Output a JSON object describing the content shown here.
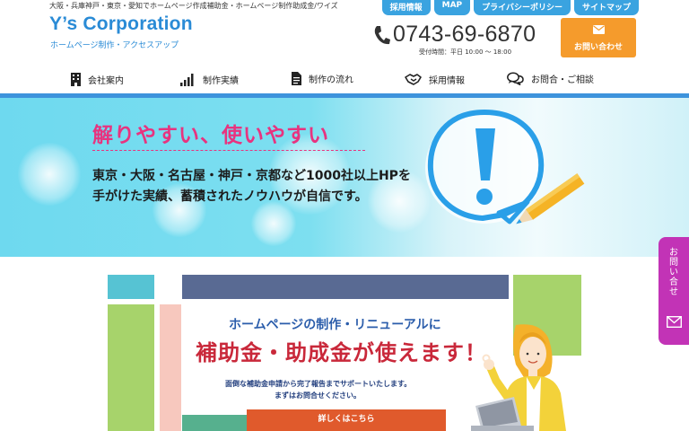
{
  "header": {
    "tagline": "大阪・兵庫神戸・東京・愛知でホームページ作成補助金・ホームページ制作助成金/ワイズ",
    "logo": "Y’s Corporation",
    "logo_sub": "ホームページ制作・アクセスアップ",
    "top_links": [
      "採用情報",
      "MAP",
      "プライバシーポリシー",
      "サイトマップ"
    ],
    "phone": "0743-69-6870",
    "hours": "受付時間：平日 10:00 ～ 18:00",
    "contact_button": "お問い合わせ"
  },
  "nav": {
    "items": [
      {
        "label": "会社案内",
        "icon": "building-icon"
      },
      {
        "label": "制作実績",
        "icon": "bar-chart-icon"
      },
      {
        "label": "制作の流れ",
        "icon": "document-icon"
      },
      {
        "label": "採用情報",
        "icon": "handshake-icon"
      },
      {
        "label": "お問合・ご相談",
        "icon": "chat-bubbles-icon"
      }
    ]
  },
  "hero": {
    "headline": "解りやすい、使いやすい",
    "line1": "東京・大阪・名古屋・神戸・京都など1000社以上HPを",
    "line2": "手がけた実績、蓄積されたノウハウが自信です。"
  },
  "banner": {
    "line1": "ホームページの制作・リニューアルに",
    "line2": "補助金・助成金が使えます！",
    "line3": "面倒な補助金申請から完了報告までサポートいたします。",
    "line4": "まずはお問合せください。",
    "button": "詳しくはこちら"
  },
  "side_tab": {
    "label": "お問い合せ",
    "icon": "envelope-icon"
  },
  "colors": {
    "brand_blue": "#2a8bd6",
    "nav_rule": "#3d93dc",
    "contact_orange": "#f59b2c",
    "headline_pink": "#e8337f",
    "banner_red": "#c9283a",
    "side_tab_purple": "#c233b6"
  }
}
